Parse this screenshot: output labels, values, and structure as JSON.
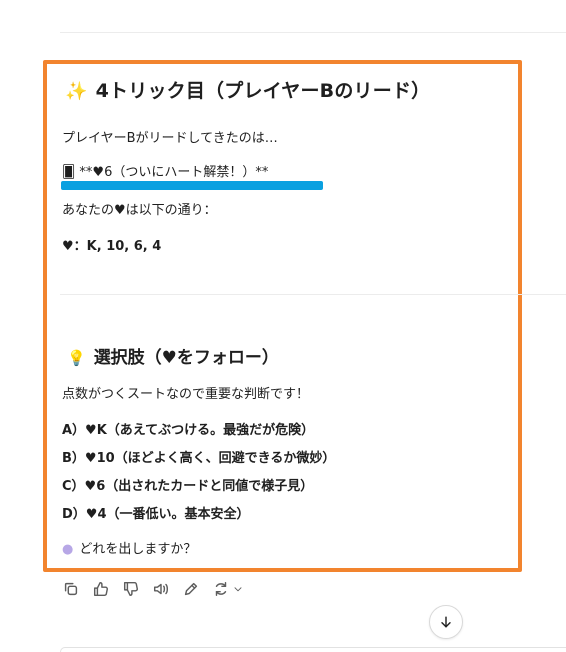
{
  "message": {
    "title": "4トリック目（プレイヤーBのリード）",
    "title_icon": "sparkles-icon",
    "lead_text": "プレイヤーBがリードしてきたのは…",
    "played_card_text": "🂠 **♥6（ついにハート解禁！）**",
    "hand_intro": "あなたの♥は以下の通り：",
    "hand_text": "♥：K, 10, 6, 4",
    "options_title": "選択肢（♥をフォロー）",
    "options_intro": "点数がつくスートなので重要な判断です！",
    "options": [
      "A）♥K（あえてぶつける。最強だが危険）",
      "B）♥10（ほどよく高く、回避できるか微妙）",
      "C）♥6（出されたカードと同値で様子見）",
      "D）♥4（一番低い。基本安全）"
    ],
    "question": "どれを出しますか？"
  },
  "toolbar": {
    "icons": [
      "copy-icon",
      "thumbs-up-icon",
      "thumbs-down-icon",
      "read-aloud-icon",
      "edit-icon",
      "regenerate-icon",
      "chevron-down-icon"
    ]
  },
  "colors": {
    "highlight_border": "#f2842e",
    "text_highlight": "#0aa0e0"
  }
}
